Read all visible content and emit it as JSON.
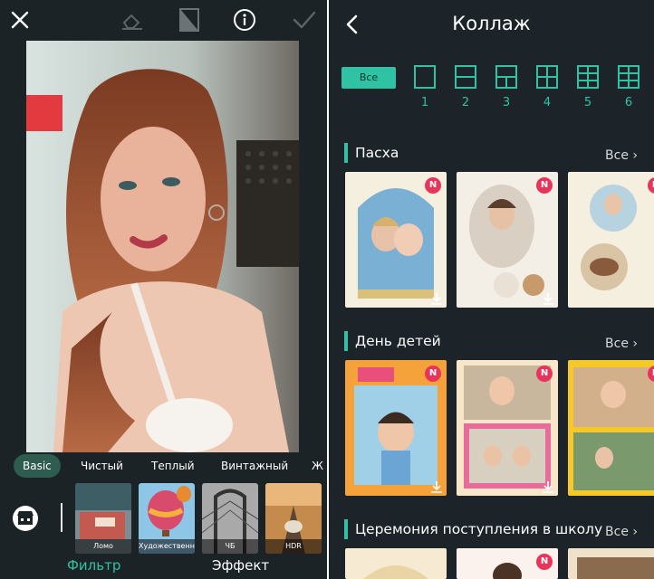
{
  "left_panel": {
    "filter_tabs": [
      "Basic",
      "Чистый",
      "Теплый",
      "Винтажный",
      "Ж"
    ],
    "thumbnails": [
      {
        "label": "Ломо",
        "icon": "lomo-thumb"
      },
      {
        "label": "Художественный",
        "icon": "balloon-thumb"
      },
      {
        "label": "ЧБ",
        "icon": "bridge-thumb"
      },
      {
        "label": "HDR",
        "icon": "road-thumb"
      }
    ],
    "bottom_tabs": {
      "filter": "Фильтр",
      "effect": "Эффект"
    },
    "accent": "#2fc3a4",
    "active_tab_bg": "#2e5c4f"
  },
  "right_panel": {
    "title": "Коллаж",
    "all_label": "Все",
    "grid_numbers": [
      "1",
      "2",
      "3",
      "4",
      "5",
      "6"
    ],
    "sections": [
      {
        "title": "Пасха",
        "all": "Все"
      },
      {
        "title": "День детей",
        "all": "Все"
      },
      {
        "title": "Церемония поступления в школу",
        "all": "Все"
      }
    ],
    "badge": "N",
    "accent": "#2fc3a4",
    "badge_color": "#e8345a"
  }
}
